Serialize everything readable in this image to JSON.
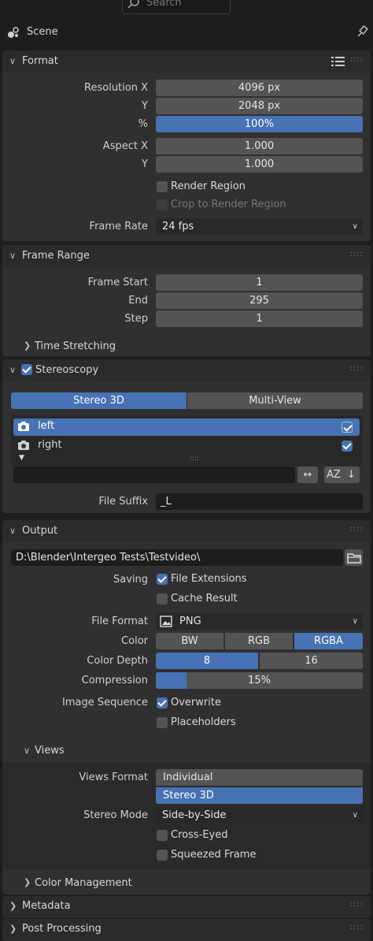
{
  "search": {
    "placeholder": "Search"
  },
  "scene": {
    "label": "Scene"
  },
  "format": {
    "title": "Format",
    "resolution_x_label": "Resolution X",
    "resolution_x": "4096 px",
    "y_label": "Y",
    "resolution_y": "2048 px",
    "percent_label": "%",
    "percent": "100%",
    "aspect_x_label": "Aspect X",
    "aspect_x": "1.000",
    "aspect_y_label": "Y",
    "aspect_y": "1.000",
    "render_region": "Render Region",
    "crop_region": "Crop to Render Region",
    "frame_rate_label": "Frame Rate",
    "frame_rate": "24 fps"
  },
  "frame_range": {
    "title": "Frame Range",
    "start_label": "Frame Start",
    "start": "1",
    "end_label": "End",
    "end": "295",
    "step_label": "Step",
    "step": "1",
    "time_stretching": "Time Stretching"
  },
  "stereoscopy": {
    "title": "Stereoscopy",
    "tab_stereo": "Stereo 3D",
    "tab_multi": "Multi-View",
    "views": [
      {
        "name": "left"
      },
      {
        "name": "right"
      }
    ],
    "sort_label": "AZ",
    "file_suffix_label": "File Suffix",
    "file_suffix": "_L"
  },
  "output": {
    "title": "Output",
    "path": "D:\\Blender\\Intergeo Tests\\Testvideo\\",
    "saving_label": "Saving",
    "file_extensions": "File Extensions",
    "cache_result": "Cache Result",
    "file_format_label": "File Format",
    "file_format": "PNG",
    "color_label": "Color",
    "color_bw": "BW",
    "color_rgb": "RGB",
    "color_rgba": "RGBA",
    "color_depth_label": "Color Depth",
    "depth_8": "8",
    "depth_16": "16",
    "compression_label": "Compression",
    "compression": "15%",
    "compression_value": 0.15,
    "image_sequence_label": "Image Sequence",
    "overwrite": "Overwrite",
    "placeholders": "Placeholders"
  },
  "views": {
    "title": "Views",
    "views_format_label": "Views Format",
    "individual": "Individual",
    "stereo_3d": "Stereo 3D",
    "stereo_mode_label": "Stereo Mode",
    "stereo_mode": "Side-by-Side",
    "cross_eyed": "Cross-Eyed",
    "squeezed_frame": "Squeezed Frame"
  },
  "collapsed": {
    "color_management": "Color Management",
    "metadata": "Metadata",
    "post_processing": "Post Processing"
  },
  "colors": {
    "accent": "#4772b3",
    "panel": "#303030",
    "field": "#545454"
  }
}
